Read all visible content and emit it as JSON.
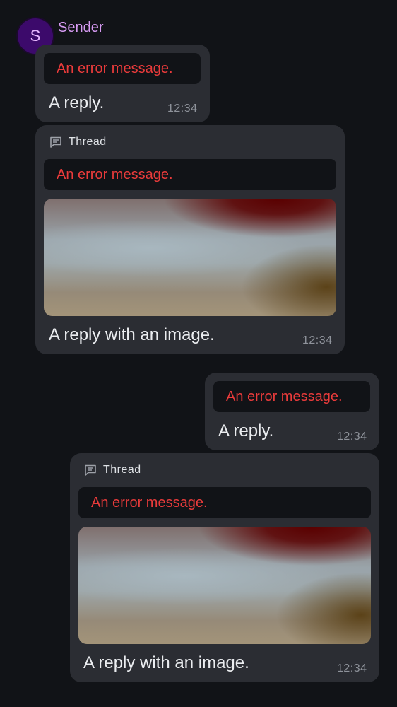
{
  "sender": {
    "avatar_initial": "S",
    "name": "Sender"
  },
  "messages": [
    {
      "error": "An error message.",
      "body": "A reply.",
      "time": "12:34"
    },
    {
      "thread_label": "Thread",
      "error": "An error message.",
      "body": "A reply with an image.",
      "time": "12:34"
    },
    {
      "error": "An error message.",
      "body": "A reply.",
      "time": "12:34"
    },
    {
      "thread_label": "Thread",
      "error": "An error message.",
      "body": "A reply with an image.",
      "time": "12:34"
    }
  ],
  "colors": {
    "background": "#111317",
    "bubble": "#2b2d33",
    "error_text": "#ea3b3b",
    "sender_name": "#d79bf3",
    "avatar_bg": "#3c0a6b"
  }
}
